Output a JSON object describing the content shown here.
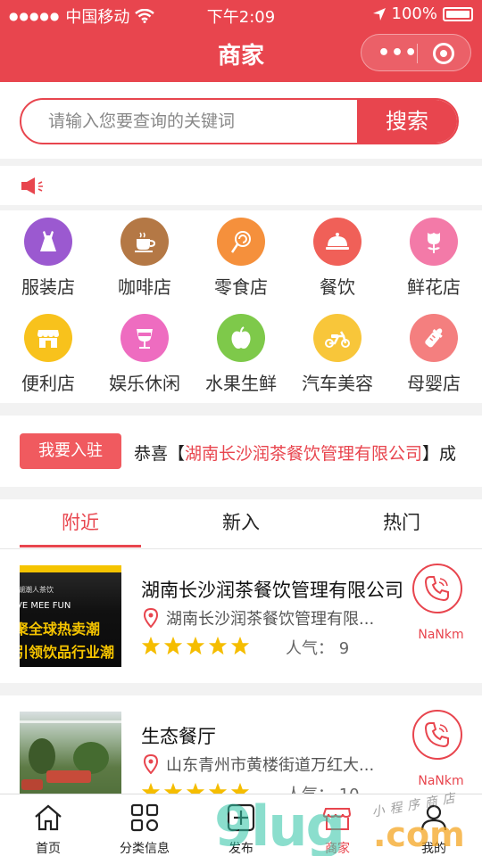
{
  "status": {
    "carrier": "中国移动",
    "time": "下午2:09",
    "battery": "100%"
  },
  "header": {
    "title": "商家"
  },
  "search": {
    "placeholder": "请输入您要查询的关键词",
    "button": "搜索"
  },
  "categories": [
    {
      "label": "服装店",
      "color": "#9b59d0",
      "icon": "dress-icon"
    },
    {
      "label": "咖啡店",
      "color": "#b47845",
      "icon": "coffee-cup-icon"
    },
    {
      "label": "零食店",
      "color": "#f5903c",
      "icon": "lollipop-icon"
    },
    {
      "label": "餐饮",
      "color": "#f06058",
      "icon": "food-cloche-icon"
    },
    {
      "label": "鲜花店",
      "color": "#f37aa8",
      "icon": "rose-icon"
    },
    {
      "label": "便利店",
      "color": "#f8c21c",
      "icon": "store-icon"
    },
    {
      "label": "娱乐休闲",
      "color": "#ee6cc0",
      "icon": "cocktail-icon"
    },
    {
      "label": "水果生鲜",
      "color": "#7ec94a",
      "icon": "apple-icon"
    },
    {
      "label": "汽车美容",
      "color": "#f8c63a",
      "icon": "scooter-icon"
    },
    {
      "label": "母婴店",
      "color": "#f47f7f",
      "icon": "baby-bottle-icon"
    }
  ],
  "join": {
    "button": "我要入驻",
    "prefix": "恭喜【",
    "company": "湖南长沙润茶餐饮管理有限公司",
    "suffix": "】成"
  },
  "tabs": [
    {
      "label": "附近"
    },
    {
      "label": "新入"
    },
    {
      "label": "热门"
    }
  ],
  "stores": [
    {
      "name": "湖南长沙润茶餐饮管理有限公司",
      "address": "湖南长沙润茶餐饮管理有限...",
      "popularity_label": "人气：",
      "popularity": "9",
      "distance": "NaNkm",
      "rating": 5,
      "thumb_text": [
        "湖潮人茶饮",
        "VE MEE FUN",
        "聚全球热卖潮",
        "引领饮品行业潮"
      ]
    },
    {
      "name": "生态餐厅",
      "address": "山东青州市黄楼街道万红大...",
      "popularity_label": "人气：",
      "popularity": "10",
      "distance": "NaNkm",
      "rating": 5
    }
  ],
  "nav": [
    {
      "label": "首页"
    },
    {
      "label": "分类信息"
    },
    {
      "label": "发布"
    },
    {
      "label": "商家"
    },
    {
      "label": "我的"
    }
  ],
  "watermark": {
    "text": "9lug",
    "domain": ".com",
    "slogan": "小程序商店"
  }
}
